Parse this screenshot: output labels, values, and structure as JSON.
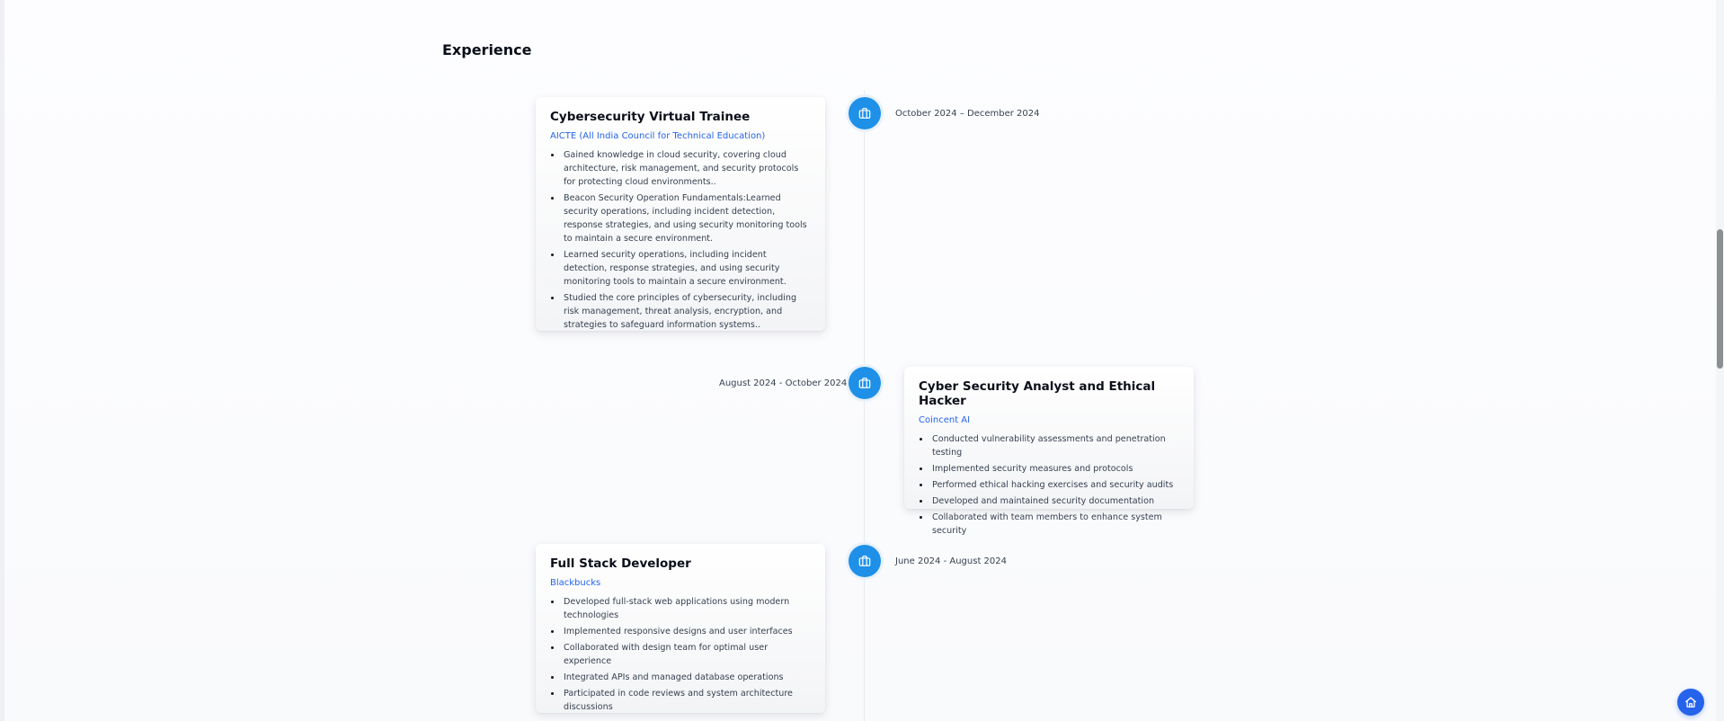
{
  "section": {
    "title": "Experience"
  },
  "experience": [
    {
      "title": "Cybersecurity Virtual Trainee",
      "company": "AICTE (All India Council for Technical Education)",
      "date": "October 2024 – December 2024",
      "icon": "briefcase-icon",
      "bullets": [
        "Gained knowledge in cloud security, covering cloud architecture, risk management, and security protocols for protecting cloud environments..",
        "Beacon Security Operation Fundamentals:Learned security operations, including incident detection, response strategies, and using security monitoring tools to maintain a secure environment.",
        "Learned security operations, including incident detection, response strategies, and using security monitoring tools to maintain a secure environment.",
        "Studied the core principles of cybersecurity, including risk management, threat analysis, encryption, and strategies to safeguard information systems.."
      ]
    },
    {
      "title": "Cyber Security Analyst and Ethical Hacker",
      "company": "Coincent AI",
      "date": "August 2024 - October 2024",
      "icon": "briefcase-icon",
      "bullets": [
        "Conducted vulnerability assessments and penetration testing",
        "Implemented security measures and protocols",
        "Performed ethical hacking exercises and security audits",
        "Developed and maintained security documentation",
        "Collaborated with team members to enhance system security"
      ]
    },
    {
      "title": "Full Stack Developer",
      "company": "Blackbucks",
      "date": "June 2024 - August 2024",
      "icon": "briefcase-icon",
      "bullets": [
        "Developed full-stack web applications using modern technologies",
        "Implemented responsive designs and user interfaces",
        "Collaborated with design team for optimal user experience",
        "Integrated APIs and managed database operations",
        "Participated in code reviews and system architecture discussions"
      ]
    }
  ],
  "fab": {
    "icon": "home-icon"
  },
  "colors": {
    "accent": "#1e90e8",
    "link": "#2563eb",
    "fab": "#2563eb"
  }
}
